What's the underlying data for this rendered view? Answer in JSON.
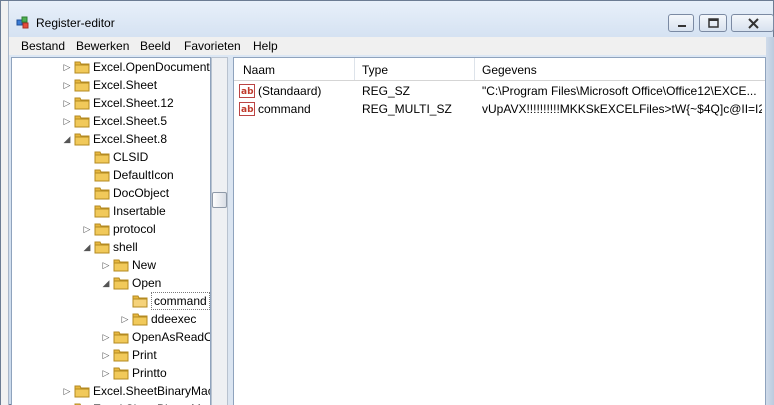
{
  "window": {
    "title": "Register-editor"
  },
  "menu": [
    "Bestand",
    "Bewerken",
    "Beeld",
    "Favorieten",
    "Help"
  ],
  "tree": [
    {
      "label": "Excel.OpenDocument",
      "expanded": false
    },
    {
      "label": "Excel.Sheet",
      "expanded": false
    },
    {
      "label": "Excel.Sheet.12",
      "expanded": false
    },
    {
      "label": "Excel.Sheet.5",
      "expanded": false
    },
    {
      "label": "Excel.Sheet.8",
      "expanded": true
    },
    {
      "label": "CLSID",
      "expanded": null
    },
    {
      "label": "DefaultIcon",
      "expanded": null
    },
    {
      "label": "DocObject",
      "expanded": null
    },
    {
      "label": "Insertable",
      "expanded": null
    },
    {
      "label": "protocol",
      "expanded": false
    },
    {
      "label": "shell",
      "expanded": true
    },
    {
      "label": "New",
      "expanded": false
    },
    {
      "label": "Open",
      "expanded": true
    },
    {
      "label": "command",
      "expanded": null,
      "selected": true
    },
    {
      "label": "ddeexec",
      "expanded": false
    },
    {
      "label": "OpenAsReadO",
      "expanded": false
    },
    {
      "label": "Print",
      "expanded": false
    },
    {
      "label": "Printto",
      "expanded": false
    },
    {
      "label": "Excel.SheetBinaryMac",
      "expanded": false
    },
    {
      "label": "Excel.SheetBinaryMa",
      "expanded": false
    }
  ],
  "list": {
    "columns": [
      "Naam",
      "Type",
      "Gegevens"
    ],
    "rows": [
      {
        "name": "(Standaard)",
        "type": "REG_SZ",
        "data": "\"C:\\Program Files\\Microsoft Office\\Office12\\EXCE..."
      },
      {
        "name": "command",
        "type": "REG_MULTI_SZ",
        "data": "vUpAVX!!!!!!!!!!MKKSkEXCELFiles>tW{~$4Q]c@II=I2..."
      }
    ]
  },
  "colors": {
    "folder": "#e8b840",
    "selection": "#7a7a7a",
    "string_icon": "#c0392b"
  }
}
